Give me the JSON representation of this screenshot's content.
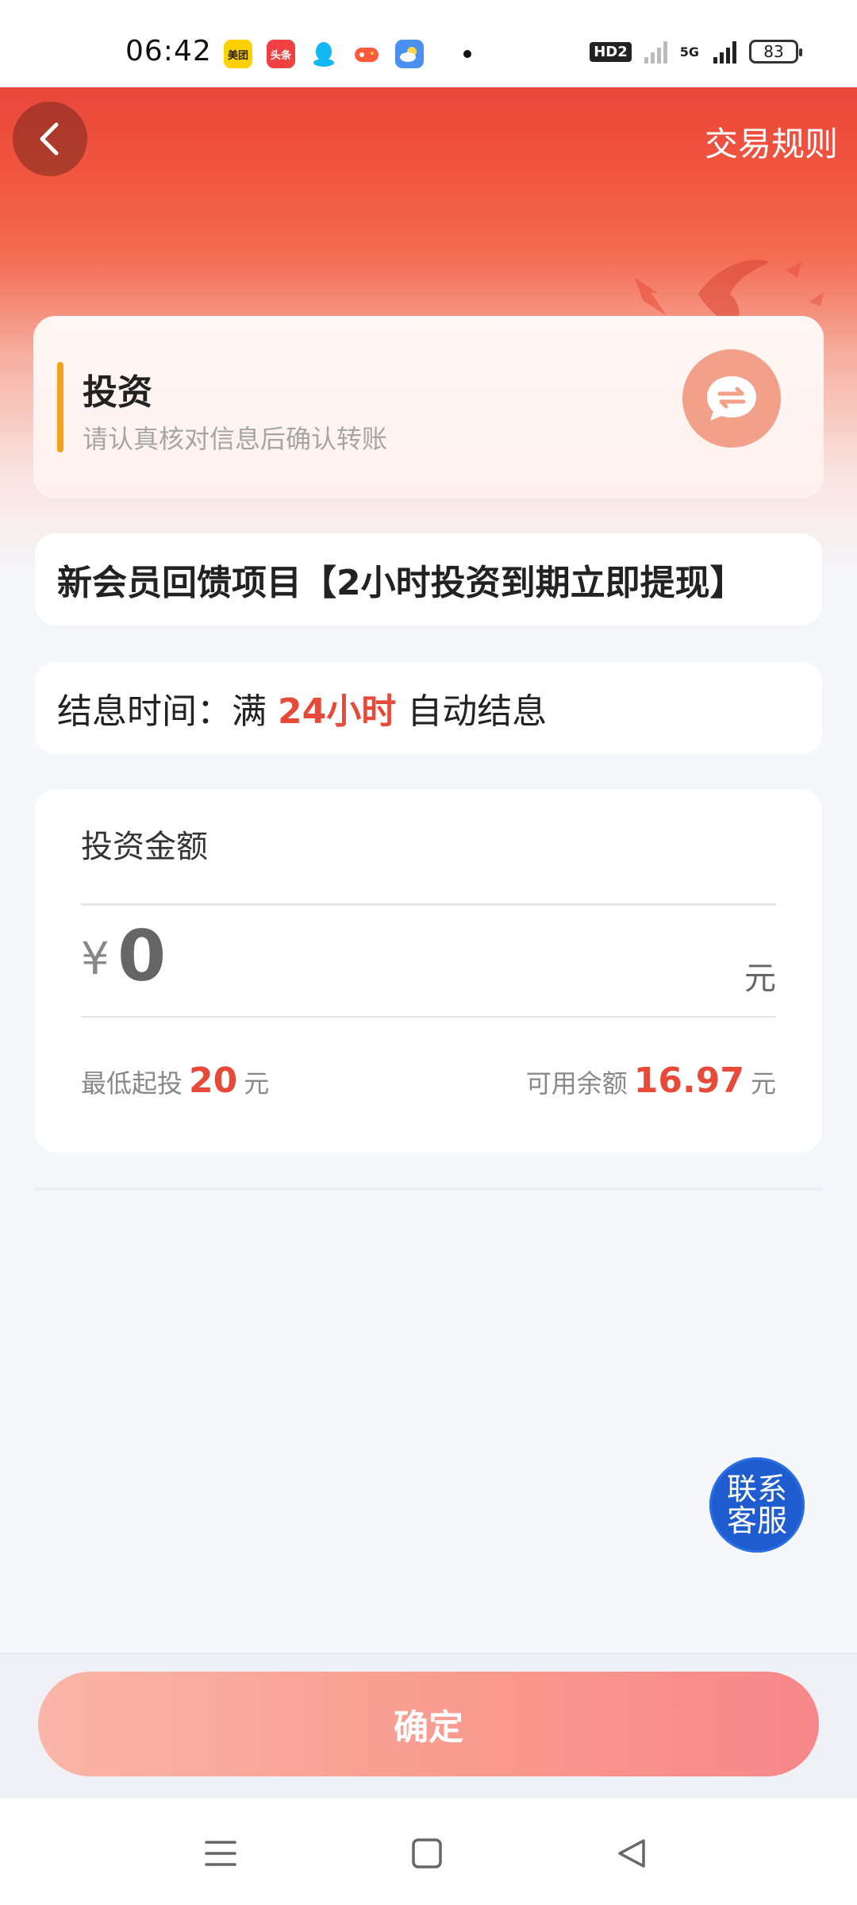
{
  "status_bar": {
    "time": "06:42",
    "apps": [
      "美团",
      "头条",
      "QQ",
      "game",
      "weather"
    ],
    "hd_badge": "HD2",
    "network": "5G",
    "battery": "83"
  },
  "header": {
    "back_icon": "chevron-left-icon",
    "rules_label": "交易规则"
  },
  "invest_card": {
    "title": "投资",
    "subtitle": "请认真核对信息后确认转账",
    "icon": "exchange-icon"
  },
  "project": {
    "name": "新会员回馈项目【2小时投资到期立即提现】"
  },
  "interest": {
    "prefix": "结息时间：满",
    "duration": "24小时",
    "suffix": "自动结息"
  },
  "amount": {
    "label": "投资金额",
    "currency_symbol": "¥",
    "value_placeholder": "0",
    "unit": "元",
    "min_label": "最低起投",
    "min_value": "20",
    "min_unit": "元",
    "balance_label": "可用余额",
    "balance_value": "16.97",
    "balance_unit": "元"
  },
  "customer_service": {
    "line1": "联系",
    "line2": "客服"
  },
  "confirm": {
    "label": "确定"
  },
  "colors": {
    "accent": "#e84a3a",
    "header": "#f1563f",
    "highlight_bar": "#f5a21b",
    "service": "#1e5cd0"
  }
}
